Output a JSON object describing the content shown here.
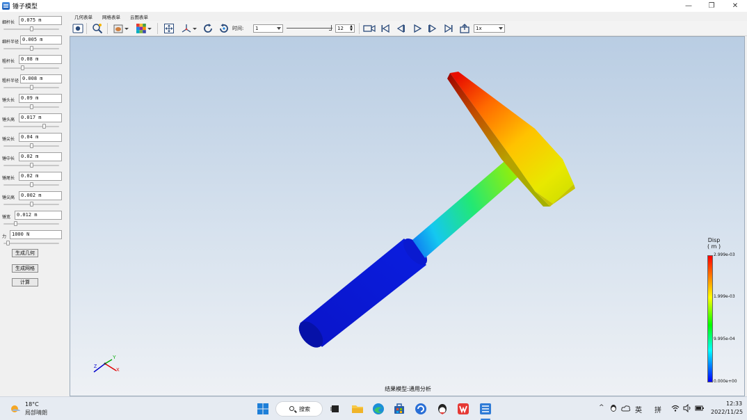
{
  "window": {
    "title": "锤子模型",
    "minimize_glyph": "—",
    "maximize_glyph": "❐",
    "close_glyph": "✕"
  },
  "left_panel": {
    "params": [
      {
        "label": "细杆长",
        "value": "0.075 m",
        "slider": 0.5
      },
      {
        "label": "细杆半径",
        "value": "0.005 m",
        "slider": 0.5
      },
      {
        "label": "粗杆长",
        "value": "0.08 m",
        "slider": 0.33
      },
      {
        "label": "粗杆半径",
        "value": "0.008 m",
        "slider": 0.5
      },
      {
        "label": "锤头长",
        "value": "0.09 m",
        "slider": 0.5
      },
      {
        "label": "锤头高",
        "value": "0.017 m",
        "slider": 0.74
      },
      {
        "label": "锤尖长",
        "value": "0.04 m",
        "slider": 0.5
      },
      {
        "label": "锤中长",
        "value": "0.02 m",
        "slider": 0.5
      },
      {
        "label": "锤尾长",
        "value": "0.02 m",
        "slider": 0.5
      },
      {
        "label": "锤尖高",
        "value": "0.002 m",
        "slider": 0.5
      },
      {
        "label": "锤宽",
        "value": "0.012 m",
        "slider": 0.2
      },
      {
        "label": "力",
        "value": "1000 N",
        "slider": 0.05
      }
    ],
    "buttons": {
      "generate_geometry": "生成几何",
      "generate_mesh": "生成网格",
      "compute": "计算"
    }
  },
  "menu": {
    "tabs": [
      "几何表单",
      "网格表单",
      "云图表单"
    ]
  },
  "toolbar": {
    "time_label": "时间:",
    "time_value": "1",
    "frame_value": "12",
    "speed_value": "1x",
    "icons": [
      "screenshot-icon",
      "zoom-fit-icon",
      "render-mode-icon",
      "contour-icon",
      "fit-view-icon",
      "axis-view-icon",
      "rotate-icon",
      "reset-view-icon",
      "record-icon",
      "first-frame-icon",
      "prev-frame-icon",
      "play-icon",
      "next-frame-icon",
      "last-frame-icon",
      "export-icon"
    ]
  },
  "viewport": {
    "model_label": "结果模型:通用分析",
    "axes": {
      "x": "X",
      "y": "Y",
      "z": "Z"
    }
  },
  "legend": {
    "title": "Disp",
    "unit": "( m )",
    "ticks": [
      "2.999e-03",
      "1.999e-03",
      "9.995e-04",
      "0.000e+00"
    ],
    "colors": [
      "#ff0000",
      "#ffff00",
      "#00ff00",
      "#00ffff",
      "#0000ff"
    ]
  },
  "taskbar": {
    "weather_temp": "18°C",
    "weather_desc": "局部晴朗",
    "search_label": "搜索",
    "ime_lang": "英",
    "ime_mode": "拼",
    "time": "12:33",
    "date": "2022/11/25"
  }
}
